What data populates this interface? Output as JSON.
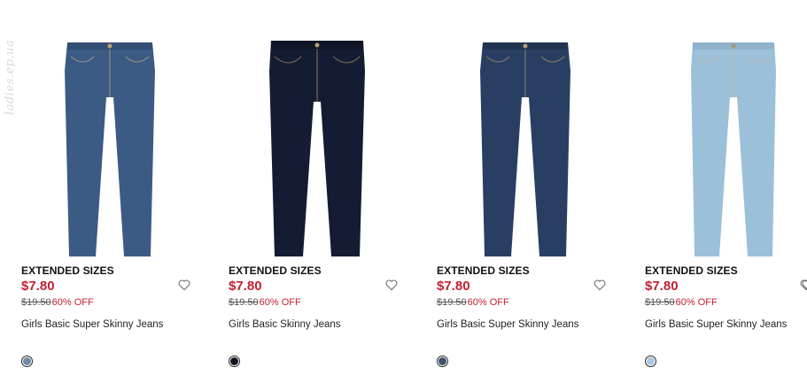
{
  "watermark": "ladies.ep.ua",
  "products": [
    {
      "badge": "EXTENDED SIZES",
      "price": "$7.80",
      "original_price": "$19.50",
      "discount": "60% OFF",
      "name": "Girls Basic Super Skinny Jeans",
      "wash_color": "#3b5b84",
      "swatch_color": "#6f8aa5"
    },
    {
      "badge": "EXTENDED SIZES",
      "price": "$7.80",
      "original_price": "$19.50",
      "discount": "60% OFF",
      "name": "Girls Basic Skinny Jeans",
      "wash_color": "#141c33",
      "swatch_color": "#111522"
    },
    {
      "badge": "EXTENDED SIZES",
      "price": "$7.80",
      "original_price": "$19.50",
      "discount": "60% OFF",
      "name": "Girls Basic Super Skinny Jeans",
      "wash_color": "#283f63",
      "swatch_color": "#3f526c"
    },
    {
      "badge": "EXTENDED SIZES",
      "price": "$7.80",
      "original_price": "$19.50",
      "discount": "60% OFF",
      "name": "Girls Basic Super Skinny Jeans",
      "wash_color": "#9cc0da",
      "swatch_color": "#a9c8df"
    }
  ],
  "icons": {
    "wishlist": "heart-outline-icon"
  }
}
